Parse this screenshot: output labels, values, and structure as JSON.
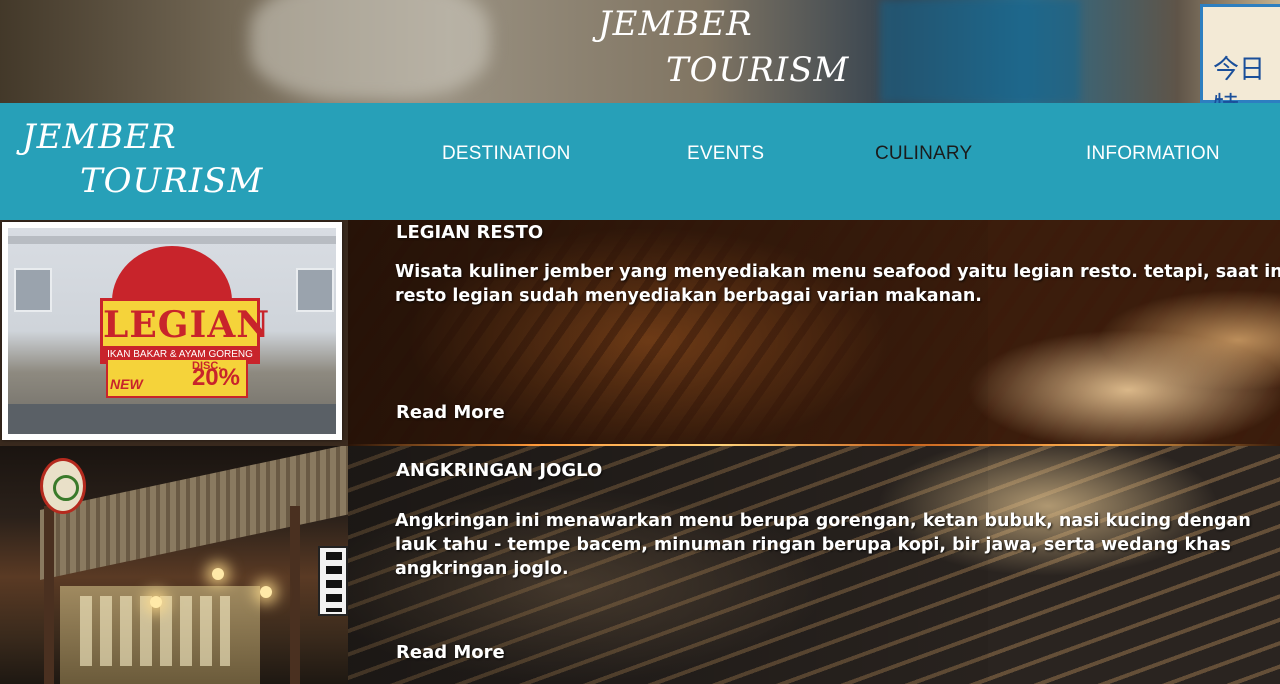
{
  "banner": {
    "title_line1": "JEMBER",
    "title_line2": "TOURISM",
    "sign_glyph": "今日特"
  },
  "logo": {
    "line1": "JEMBER",
    "line2": "TOURISM"
  },
  "nav": {
    "items": [
      {
        "label": "DESTINATION"
      },
      {
        "label": "EVENTS"
      },
      {
        "label": "CULINARY"
      },
      {
        "label": "INFORMATION"
      }
    ],
    "active": "CULINARY"
  },
  "colors": {
    "nav_bg": "#27a0b8",
    "active_nav_text": "#1b1b1b",
    "text": "#ffffff"
  },
  "items": [
    {
      "title": "LEGIAN RESTO",
      "description": "Wisata kuliner jember yang menyediakan menu seafood yaitu legian resto. tetapi, saat ini resto legian sudah menyediakan berbagai varian makanan.",
      "read_more": "Read More",
      "photo_sign": {
        "name": "LEGIAN",
        "subtitle": "IKAN BAKAR & AYAM GORENG",
        "disc": "DISC.",
        "percent": "20%",
        "new": "NEW"
      }
    },
    {
      "title": "ANGKRINGAN JOGLO",
      "description": "Angkringan ini menawarkan menu berupa gorengan, ketan bubuk, nasi kucing dengan lauk tahu - tempe bacem, minuman ringan berupa kopi, bir jawa, serta wedang khas angkringan joglo.",
      "read_more": "Read More"
    }
  ]
}
